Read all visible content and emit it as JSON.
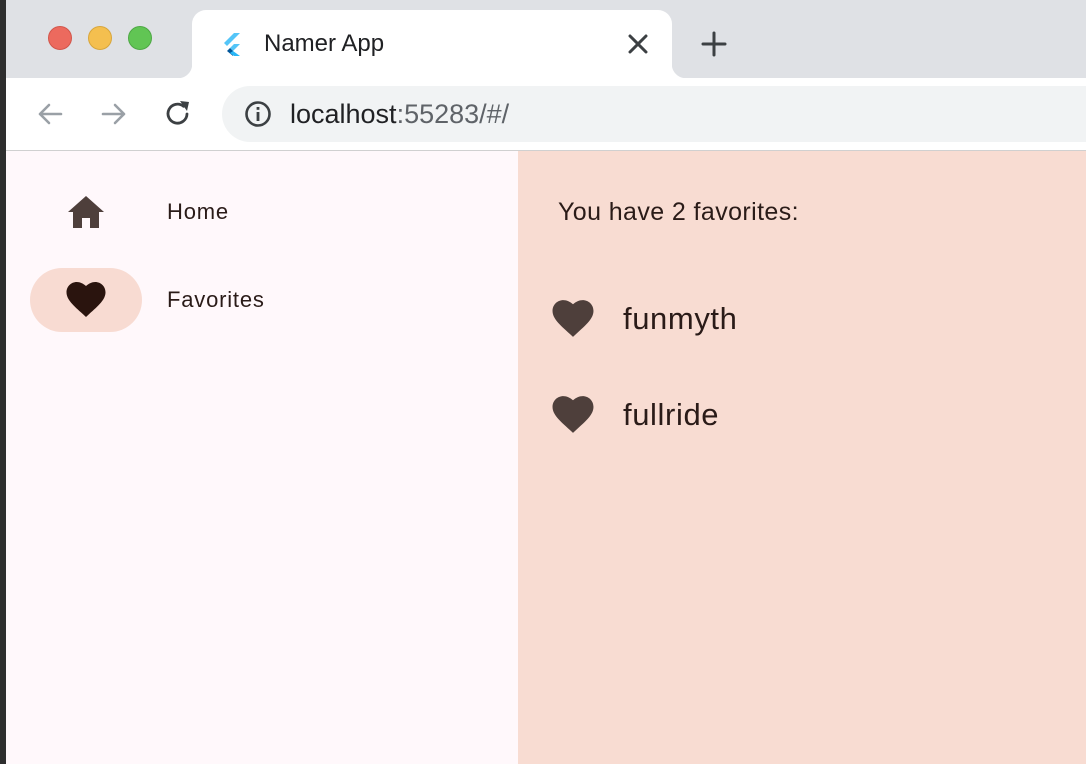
{
  "browser": {
    "tab_title": "Namer App",
    "url_host": "localhost",
    "url_rest": ":55283/#/",
    "icons": {
      "favicon": "flutter-logo-icon",
      "close": "close-icon",
      "new_tab": "plus-icon",
      "back": "arrow-left-icon",
      "forward": "arrow-right-icon",
      "reload": "reload-icon",
      "site_info": "info-icon"
    }
  },
  "nav_rail": {
    "items": [
      {
        "label": "Home",
        "icon": "home-icon",
        "selected": false
      },
      {
        "label": "Favorites",
        "icon": "heart-icon",
        "selected": true
      }
    ]
  },
  "main": {
    "heading": "You have 2 favorites:",
    "favorites": [
      {
        "label": "funmyth",
        "icon": "heart-icon"
      },
      {
        "label": "fullride",
        "icon": "heart-icon"
      }
    ]
  },
  "colors": {
    "rail_background": "#fff8fb",
    "selected_indicator": "#f8dbd2",
    "content_background": "#f8dcd2",
    "icon_color": "#4e3f3b",
    "text_color": "#2a1b18"
  }
}
